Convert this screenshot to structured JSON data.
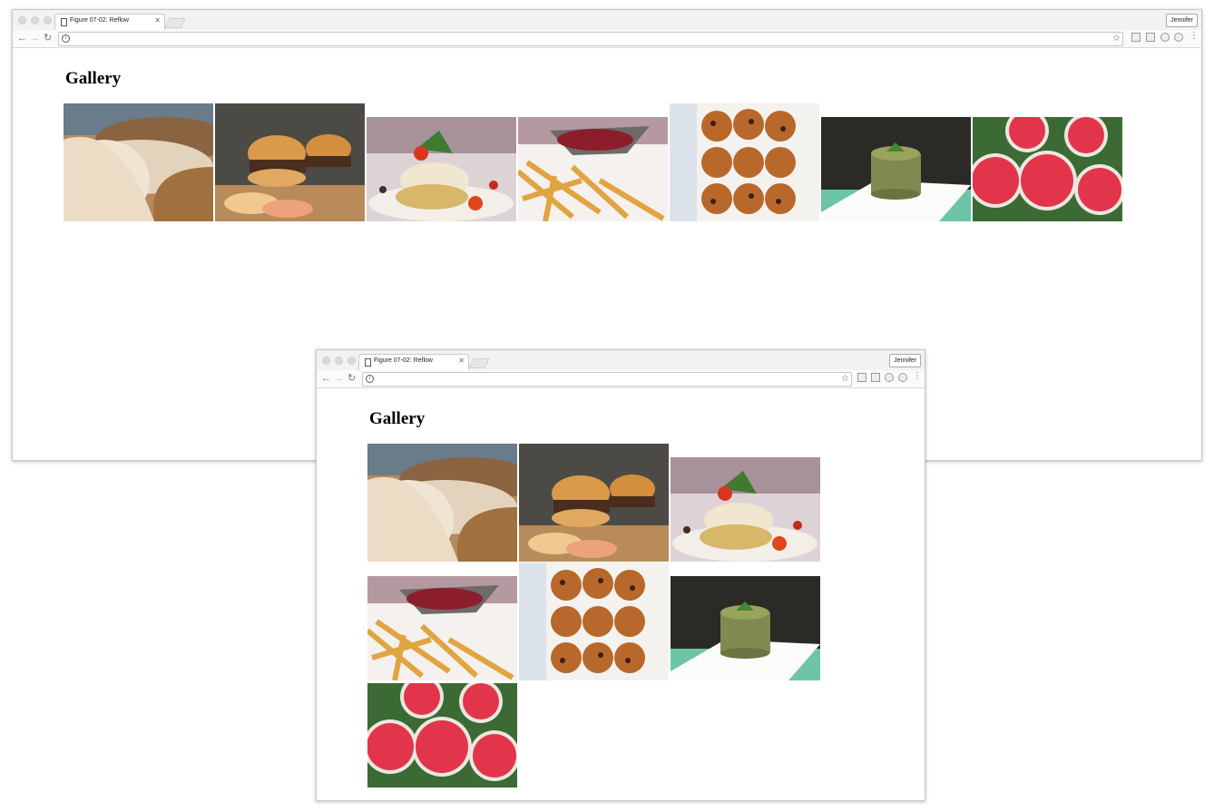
{
  "windows": [
    {
      "tab_title": "Figure 07-02: Reflow",
      "user": "Jennifer",
      "heading": "Gallery"
    },
    {
      "tab_title": "Figure 07-02: Reflow",
      "user": "Jennifer",
      "heading": "Gallery"
    }
  ],
  "gallery": [
    {
      "name": "bread-photo",
      "icon": "bread-loaf-image"
    },
    {
      "name": "burgers-photo",
      "icon": "burger-image"
    },
    {
      "name": "fish-dish-photo",
      "icon": "fish-plate-image"
    },
    {
      "name": "fries-photo",
      "icon": "fries-sauce-image"
    },
    {
      "name": "muffins-photo",
      "icon": "muffin-tray-image"
    },
    {
      "name": "tabbouleh-photo",
      "icon": "grain-salad-image"
    },
    {
      "name": "watermelon-photo",
      "icon": "watermelon-slices-image"
    }
  ],
  "colors": {
    "chrome": "#f2f2f2",
    "border": "#c8c8c8",
    "text": "#000000"
  }
}
